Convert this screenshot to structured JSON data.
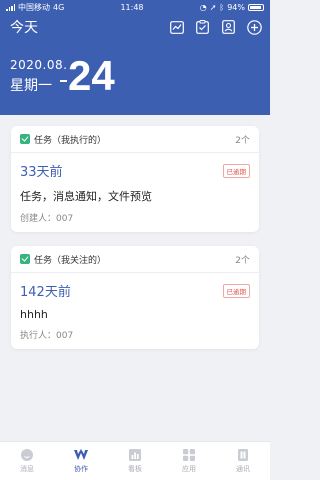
{
  "status_bar": {
    "carrier": "中国移动",
    "network": "4G",
    "time": "11:48",
    "battery": "94%",
    "battery_level": 0.94
  },
  "header": {
    "title": "今天",
    "toolbar_icons": [
      "chart-icon",
      "clipboard-icon",
      "contact-card-icon",
      "add-icon"
    ],
    "date_year_month": "2020.08.",
    "date_weekday": "星期一",
    "date_day": "24"
  },
  "cards": [
    {
      "section_title": "任务（我执行的）",
      "count": "2个",
      "ago": "33天前",
      "status": "已逾期",
      "task_title": "任务，消息通知，文件预览",
      "person": "创建人：007"
    },
    {
      "section_title": "任务（我关注的）",
      "count": "2个",
      "ago": "142天前",
      "status": "已逾期",
      "task_title": "hhhh",
      "person": "执行人：007"
    }
  ],
  "tabbar": {
    "items": [
      {
        "label": "消息",
        "icon": "message-icon"
      },
      {
        "label": "协作",
        "icon": "collaboration-icon",
        "active": true
      },
      {
        "label": "看板",
        "icon": "board-icon"
      },
      {
        "label": "应用",
        "icon": "apps-icon"
      },
      {
        "label": "通讯",
        "icon": "contacts-icon"
      }
    ]
  },
  "colors": {
    "brand": "#3d5fb2",
    "task_icon": "#36b37e",
    "overdue": "#e5534b",
    "background": "#f0f1f5"
  }
}
